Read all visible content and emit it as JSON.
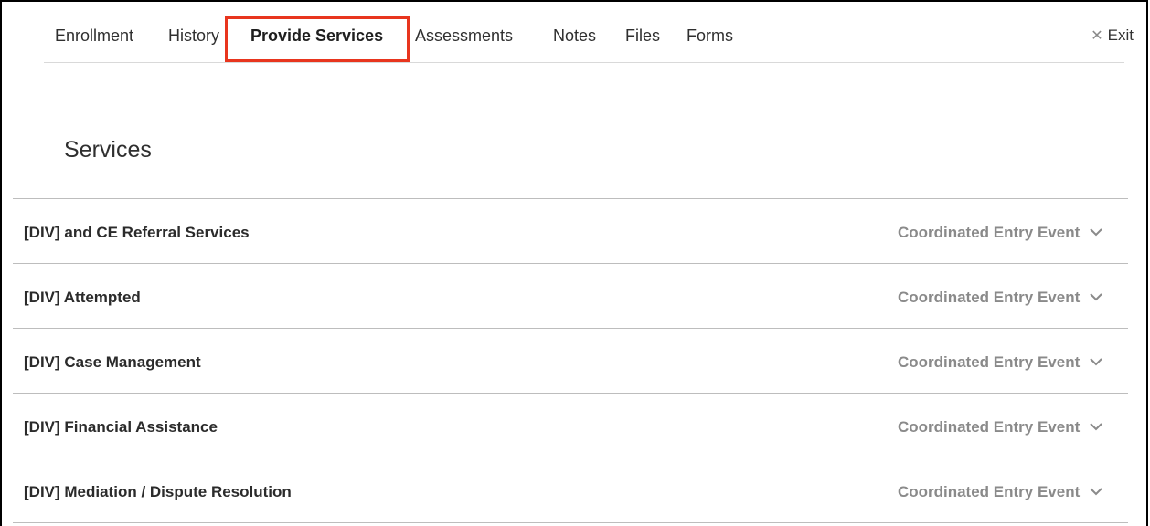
{
  "nav": {
    "tabs": [
      {
        "label": "Enrollment"
      },
      {
        "label": "History"
      },
      {
        "label": "Provide Services"
      },
      {
        "label": "Assessments"
      },
      {
        "label": "Notes"
      },
      {
        "label": "Files"
      },
      {
        "label": "Forms"
      }
    ],
    "exit_label": "Exit",
    "active_tab": "Provide Services"
  },
  "page": {
    "title": "Services"
  },
  "services": [
    {
      "name": "[DIV] and CE Referral Services",
      "type": "Coordinated Entry Event"
    },
    {
      "name": "[DIV] Attempted",
      "type": "Coordinated Entry Event"
    },
    {
      "name": "[DIV] Case Management",
      "type": "Coordinated Entry Event"
    },
    {
      "name": "[DIV] Financial Assistance",
      "type": "Coordinated Entry Event"
    },
    {
      "name": "[DIV] Mediation / Dispute Resolution",
      "type": "Coordinated Entry Event"
    }
  ],
  "colors": {
    "highlight": "#e8351e",
    "muted": "#8a8a8a"
  },
  "icons": {
    "exit": "close-icon",
    "row_toggle": "chevron-down-icon"
  }
}
